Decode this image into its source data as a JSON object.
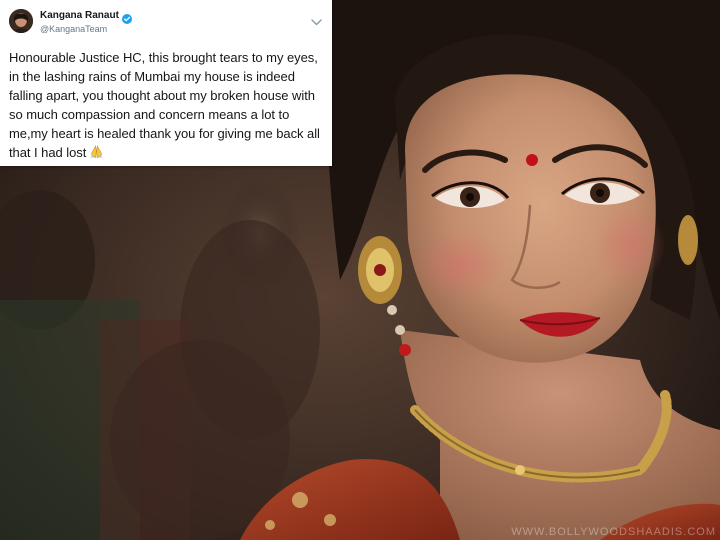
{
  "tweet": {
    "display_name": "Kangana Ranaut",
    "handle": "@KanganaTeam",
    "text": "Honourable Justice HC, this brought tears to my eyes, in the lashing rains of Mumbai my house is indeed  falling apart, you thought about my broken house with so much compassion and concern means a lot to me,my heart is healed thank you for giving me back all that I had lost",
    "verified": true,
    "menu_icon": "chevron-down-icon",
    "emoji_icon": "folded-hands-icon"
  },
  "background": {
    "description_icon": "photo-background",
    "watermark": "WWW.BOLLYWOODSHAADIS.COM"
  },
  "colors": {
    "card_bg": "#ffffff",
    "text": "#14171a",
    "handle": "#657786",
    "verified": "#1da1f2"
  }
}
